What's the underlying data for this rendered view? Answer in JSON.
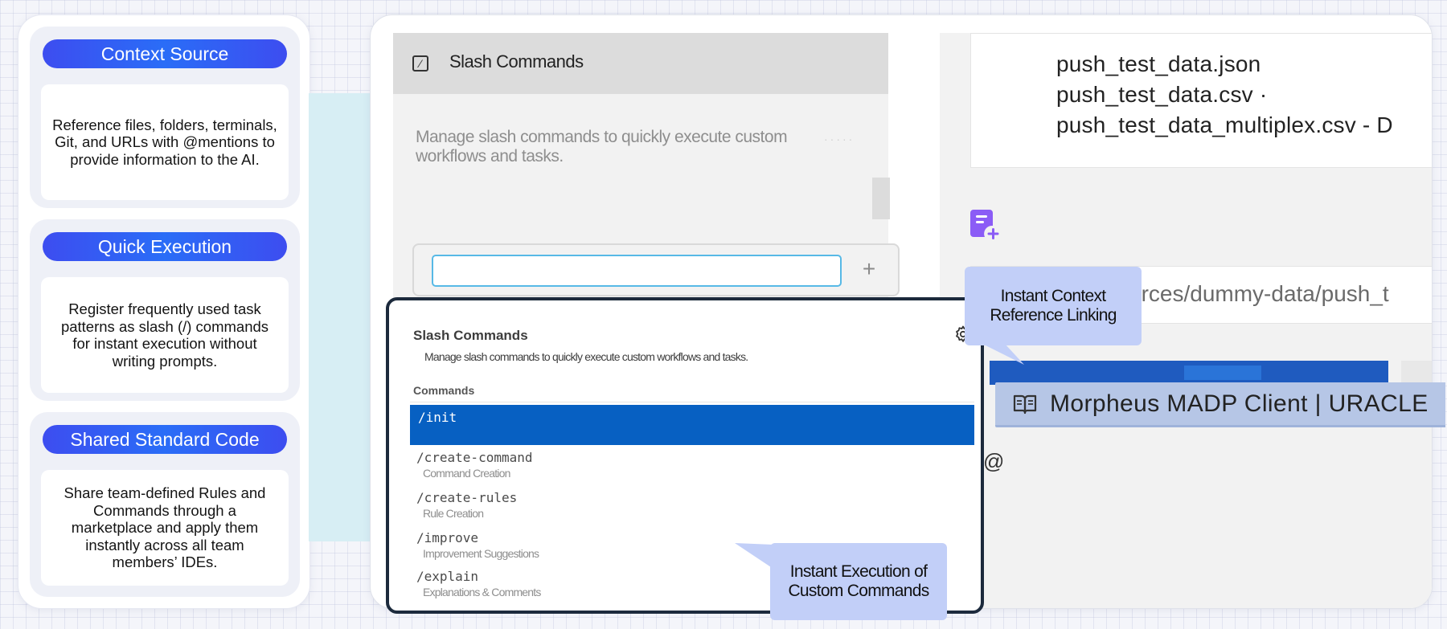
{
  "features": [
    {
      "title": "Context Source",
      "description": "Reference files, folders, terminals, Git, and URLs with @mentions to provide information to the AI."
    },
    {
      "title": "Quick Execution",
      "description": "Register frequently used task patterns as slash (/) commands for instant execution without writing prompts."
    },
    {
      "title": "Shared Standard Code",
      "description": "Share team-defined Rules and Commands through a marketplace and apply them instantly across all team members’ IDEs."
    }
  ],
  "settings": {
    "title": "Slash Commands",
    "description": "Manage slash commands to quickly execute custom workflows and tasks.",
    "add_symbol": "+"
  },
  "files": [
    "push_test_data.json",
    "push_test_data.csv ·",
    "push_test_data_multiplex.csv - D"
  ],
  "path_text": "urces/dummy-data/push_t",
  "at_symbol": "@",
  "client_label": "Morpheus MADP Client | URACLE",
  "popup": {
    "title": "Slash Commands",
    "description": "Manage slash commands to quickly execute custom workflows and tasks.",
    "commands_label": "Commands",
    "selected": "/init",
    "commands": [
      {
        "name": "/create-command",
        "sub": "Command Creation"
      },
      {
        "name": "/create-rules",
        "sub": "Rule Creation"
      },
      {
        "name": "/improve",
        "sub": "Improvement Suggestions"
      },
      {
        "name": "/explain",
        "sub": "Explanations & Comments"
      }
    ]
  },
  "callouts": {
    "context": "Instant Context Reference Linking",
    "execution": "Instant Execution of Custom Commands"
  },
  "colors": {
    "pill_gradient_start": "#3d4df0",
    "pill_gradient_mid": "#2a6df7",
    "selected_command": "#0760c2",
    "callout": "#c2cff8",
    "popup_border": "#1c2a3c",
    "doc_icon": "#8b5cf6"
  },
  "icons": {
    "settings": "slash-square-icon",
    "gear": "gear-icon",
    "document": "document-add-icon",
    "book": "book-open-icon"
  }
}
